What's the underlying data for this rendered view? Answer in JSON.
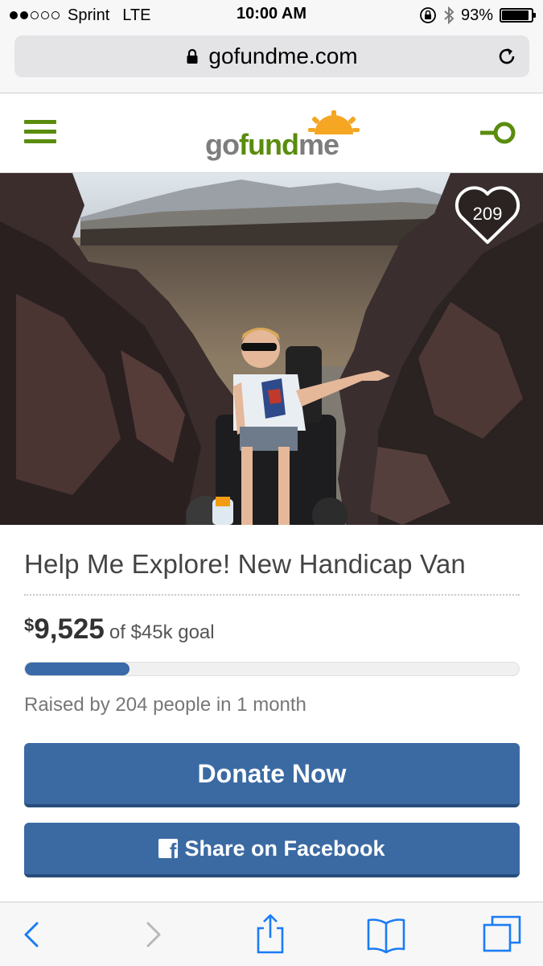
{
  "status_bar": {
    "signal_bars_filled": 2,
    "signal_bars_total": 5,
    "carrier": "Sprint",
    "network": "LTE",
    "time": "10:00 AM",
    "battery_percent": "93%",
    "battery_level": 0.93
  },
  "browser": {
    "url": "gofundme.com"
  },
  "site": {
    "logo": {
      "go": "go",
      "fund": "fund",
      "me": "me"
    },
    "brand_color": "#5a8c0d"
  },
  "hero": {
    "heart_count": "209"
  },
  "campaign": {
    "title": "Help Me Explore! New Handicap Van",
    "amount_currency": "$",
    "amount_value": "9,525",
    "goal_text": "of $45k goal",
    "progress_fraction": 0.2117,
    "raised_by": "Raised by 204 people in 1 month",
    "donate_label": "Donate Now",
    "share_label": "Share on Facebook",
    "button_color": "#3b6aa3"
  },
  "toolbar": {
    "icons": [
      "back-icon",
      "forward-icon",
      "share-icon",
      "bookmarks-icon",
      "tabs-icon"
    ],
    "tint": "#1a7cf5"
  }
}
